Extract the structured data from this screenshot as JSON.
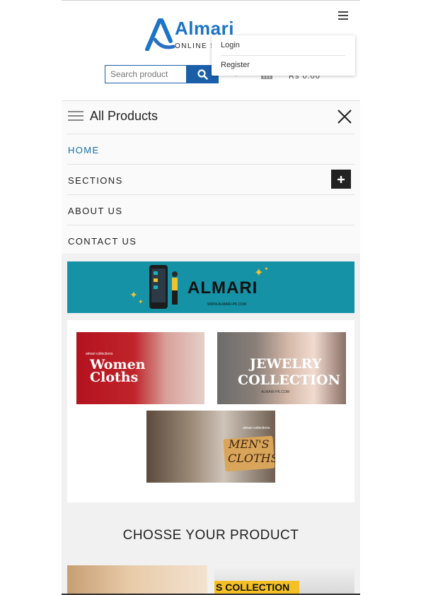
{
  "header": {
    "brand": "Almari",
    "tagline": "ONLINE S",
    "search": {
      "placeholder": "Search product"
    },
    "cart_price": "Rs 0.00"
  },
  "account_menu": {
    "items": [
      "Login",
      "Register"
    ]
  },
  "nav": {
    "title": "All Products",
    "items": [
      "HOME",
      "SECTIONS",
      "ABOUT US",
      "CONTACT US"
    ]
  },
  "banner": {
    "brand": "ALMARI",
    "url": "WWW.ALMARI-PK.COM"
  },
  "collections": {
    "women": {
      "small": "almari collections",
      "title_line1": "Women",
      "title_line2": "Cloths"
    },
    "jewelry": {
      "title_line1": "JEWELRY",
      "title_line2": "COLLECTION",
      "url": "ALMARI-PK.COM"
    },
    "men": {
      "small": "almari collections",
      "title_line1": "MEN'S",
      "title_line2": "CLOTHS"
    }
  },
  "section_heading": "CHOSSE YOUR PRODUCT",
  "thumbs": {
    "second_label": "S COLLECTION"
  },
  "colors": {
    "brand_blue": "#1a74c8",
    "search_blue": "#1a5fa8",
    "banner_teal": "#1592a6",
    "active_link": "#1a6fa8"
  }
}
